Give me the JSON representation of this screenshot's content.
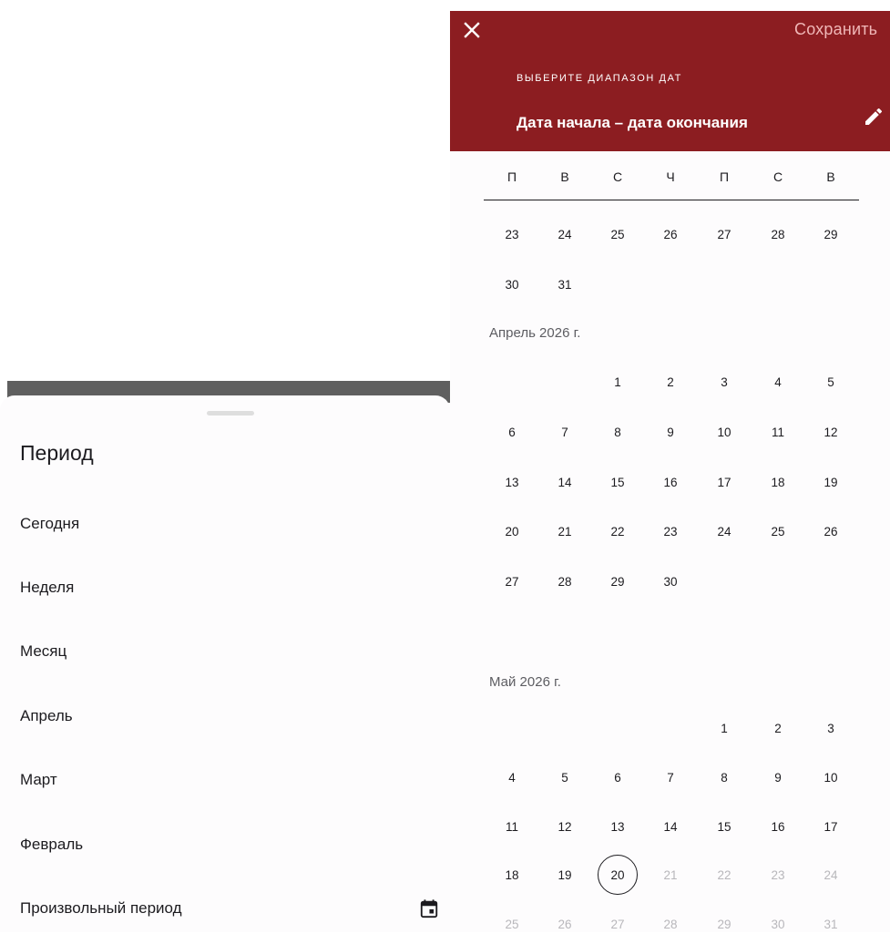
{
  "sheet": {
    "title": "Период",
    "items": [
      {
        "label": "Сегодня"
      },
      {
        "label": "Неделя"
      },
      {
        "label": "Месяц"
      },
      {
        "label": "Апрель"
      },
      {
        "label": "Март"
      },
      {
        "label": "Февраль"
      },
      {
        "label": "Произвольный период",
        "icon": "calendar-icon"
      }
    ]
  },
  "picker": {
    "close_icon": "close-icon",
    "save_label": "Сохранить",
    "overline": "ВЫБЕРИТЕ ДИАПАЗОН ДАТ",
    "range_title": "Дата начала – дата окончания",
    "edit_icon": "pencil-icon",
    "header_color": "#8c1d21",
    "weekdays": [
      "П",
      "В",
      "С",
      "Ч",
      "П",
      "С",
      "В"
    ],
    "months": [
      {
        "label": "",
        "rows": [
          [
            "23",
            "24",
            "25",
            "26",
            "27",
            "28",
            "29"
          ],
          [
            "30",
            "31",
            "",
            "",
            "",
            "",
            ""
          ]
        ]
      },
      {
        "label": "Апрель 2026 г.",
        "rows": [
          [
            "",
            "",
            "1",
            "2",
            "3",
            "4",
            "5"
          ],
          [
            "6",
            "7",
            "8",
            "9",
            "10",
            "11",
            "12"
          ],
          [
            "13",
            "14",
            "15",
            "16",
            "17",
            "18",
            "19"
          ],
          [
            "20",
            "21",
            "22",
            "23",
            "24",
            "25",
            "26"
          ],
          [
            "27",
            "28",
            "29",
            "30",
            "",
            "",
            ""
          ]
        ]
      },
      {
        "label": "Май 2026 г.",
        "rows": [
          [
            "",
            "",
            "",
            "",
            "1",
            "2",
            "3"
          ],
          [
            "4",
            "5",
            "6",
            "7",
            "8",
            "9",
            "10"
          ],
          [
            "11",
            "12",
            "13",
            "14",
            "15",
            "16",
            "17"
          ],
          [
            "18",
            "19",
            "20",
            "21",
            "22",
            "23",
            "24"
          ],
          [
            "25",
            "26",
            "27",
            "28",
            "29",
            "30",
            "31"
          ]
        ]
      }
    ],
    "today": "20",
    "today_month_index": 2,
    "disabled_after_today": true
  }
}
